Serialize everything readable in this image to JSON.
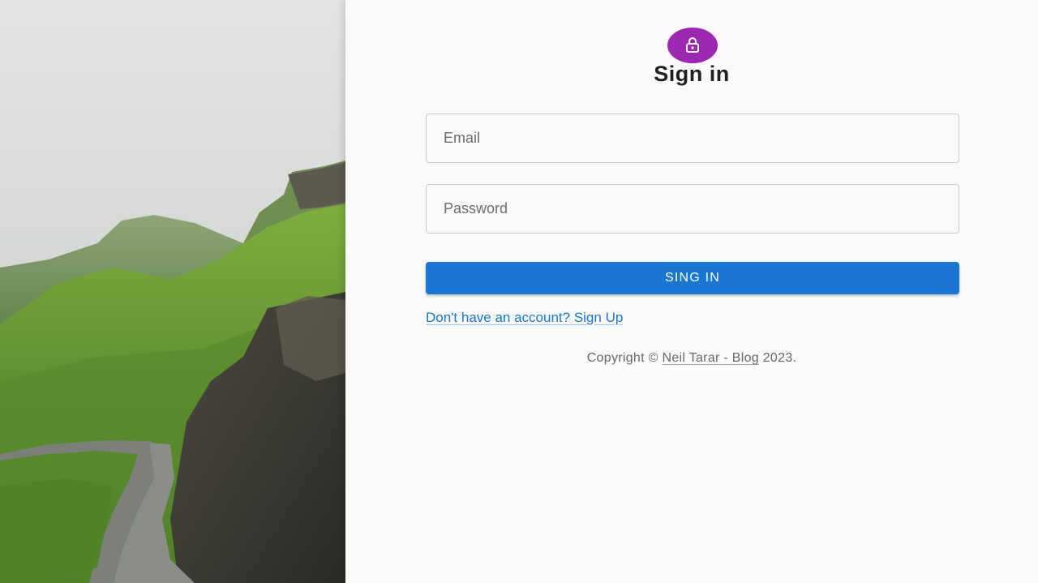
{
  "hero": {
    "icon": "landscape-image"
  },
  "form": {
    "avatar_icon": "lock-icon",
    "title": "Sign in",
    "email": {
      "placeholder": "Email",
      "value": ""
    },
    "password": {
      "placeholder": "Password",
      "value": ""
    },
    "submit_label": "SING IN",
    "signup_link": "Don't have an account? Sign Up"
  },
  "footer": {
    "prefix": "Copyright © ",
    "link": "Neil Tarar - Blog",
    "suffix": " 2023."
  },
  "colors": {
    "accent": "#1976d2",
    "avatar": "#9c27b0",
    "background": "#fafafa"
  }
}
